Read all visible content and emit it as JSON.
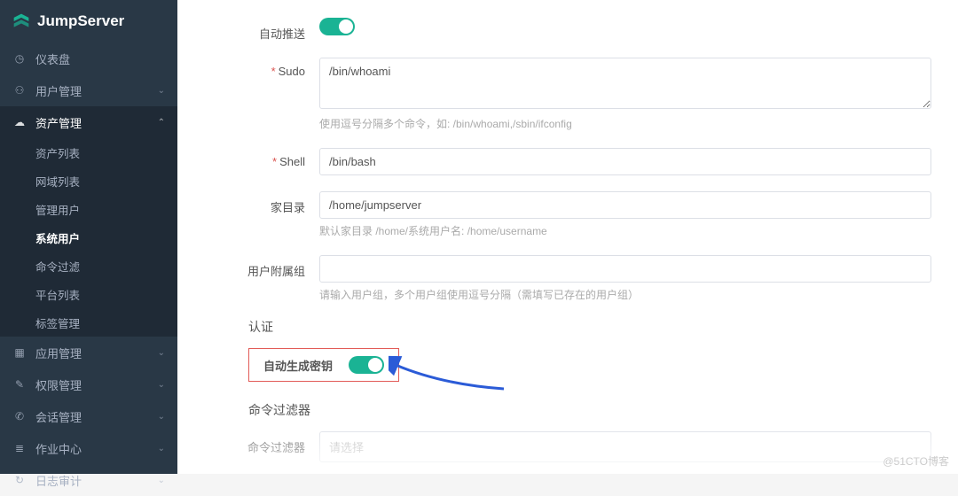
{
  "brand": "JumpServer",
  "menu": {
    "dashboard": "仪表盘",
    "users": "用户管理",
    "assets": "资产管理",
    "apps": "应用管理",
    "perms": "权限管理",
    "sessions": "会话管理",
    "jobs": "作业中心",
    "audit": "日志审计",
    "sub": {
      "asset_list": "资产列表",
      "domain_list": "网域列表",
      "admin_user": "管理用户",
      "system_user": "系统用户",
      "cmd_filter": "命令过滤",
      "platform_list": "平台列表",
      "tag_mgmt": "标签管理"
    }
  },
  "form": {
    "auto_push_label": "自动推送",
    "sudo_label": "Sudo",
    "sudo_value": "/bin/whoami",
    "sudo_help": "使用逗号分隔多个命令，如: /bin/whoami,/sbin/ifconfig",
    "shell_label": "Shell",
    "shell_value": "/bin/bash",
    "home_label": "家目录",
    "home_value": "/home/jumpserver",
    "home_help": "默认家目录 /home/系统用户名: /home/username",
    "groups_label": "用户附属组",
    "groups_value": "",
    "groups_help": "请输入用户组，多个用户组使用逗号分隔（需填写已存在的用户组）"
  },
  "section": {
    "auth": "认证",
    "auto_gen_key": "自动生成密钥",
    "cmd_filter_title": "命令过滤器",
    "cmd_filter_label": "命令过滤器",
    "cmd_filter_placeholder": "请选择"
  },
  "watermark": "@51CTO博客"
}
